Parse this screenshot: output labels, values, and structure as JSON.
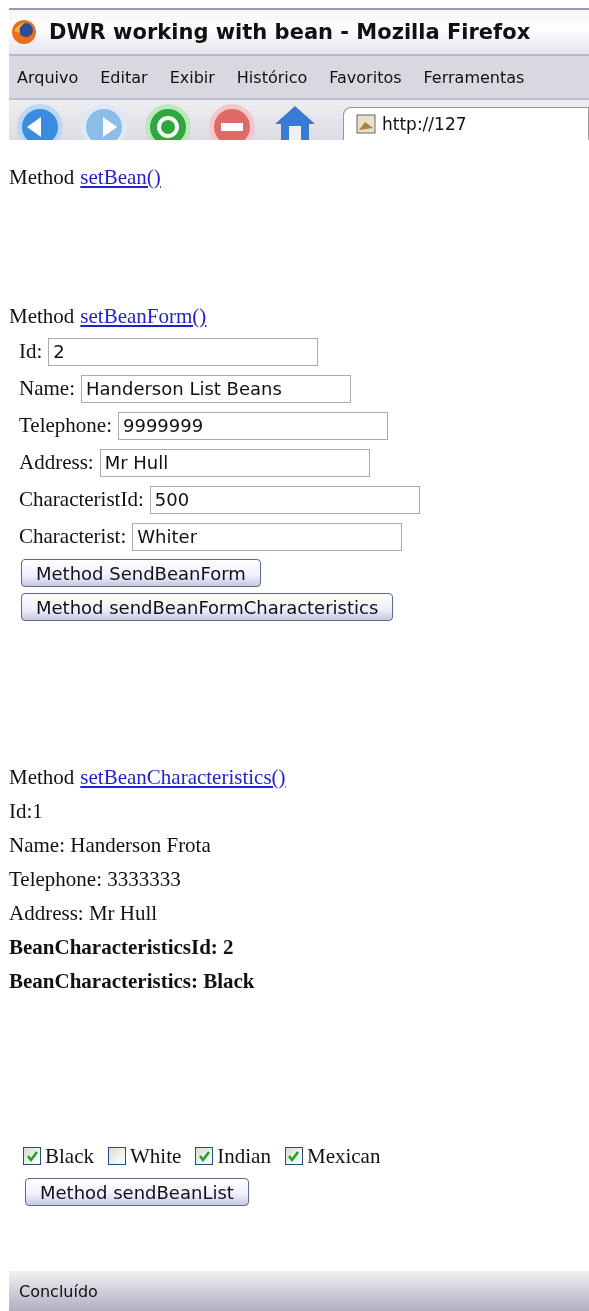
{
  "window": {
    "title": "DWR working with bean - Mozilla Firefox"
  },
  "menu": [
    "Arquivo",
    "Editar",
    "Exibir",
    "Histórico",
    "Favoritos",
    "Ferramentas"
  ],
  "toolbar": {
    "address": "http://127"
  },
  "bean_section": {
    "label": "Method",
    "link": "setBean()"
  },
  "form_section": {
    "label": "Method",
    "link": "setBeanForm()",
    "fields": [
      {
        "label": "Id:",
        "value": "2"
      },
      {
        "label": "Name:",
        "value": "Handerson List Beans"
      },
      {
        "label": "Telephone:",
        "value": "9999999"
      },
      {
        "label": "Address:",
        "value": "Mr Hull"
      },
      {
        "label": "CharacteristId:",
        "value": "500"
      },
      {
        "label": "Characterist:",
        "value": "Whiter"
      }
    ],
    "buttons": [
      "Method SendBeanForm",
      "Method sendBeanFormCharacteristics"
    ]
  },
  "characteristics_section": {
    "label": "Method",
    "link": "setBeanCharacteristics()",
    "lines": [
      {
        "text": "Id:1",
        "bold": false
      },
      {
        "text": "Name: Handerson Frota",
        "bold": false
      },
      {
        "text": "Telephone: 3333333",
        "bold": false
      },
      {
        "text": "Address: Mr Hull",
        "bold": false
      },
      {
        "text": "BeanCharacteristicsId: 2",
        "bold": true
      },
      {
        "text": "BeanCharacteristics: Black",
        "bold": true
      }
    ]
  },
  "list_section": {
    "options": [
      {
        "label": "Black",
        "checked": true
      },
      {
        "label": "White",
        "checked": false
      },
      {
        "label": "Indian",
        "checked": true
      },
      {
        "label": "Mexican",
        "checked": true
      }
    ],
    "button": "Method sendBeanList"
  },
  "status_bar": {
    "text": "Concluído"
  }
}
